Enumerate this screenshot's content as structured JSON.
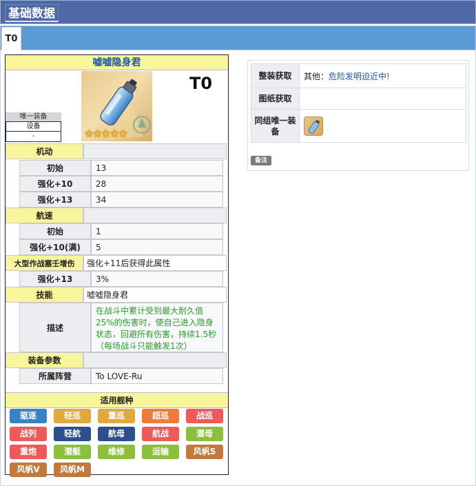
{
  "header": {
    "title": "基础数据"
  },
  "tabs": [
    {
      "label": "T0"
    }
  ],
  "equipment": {
    "name": "嘘嘘隐身君",
    "tier": "T0",
    "rarity_stars": "★★★★★",
    "unique_label": "唯一装备",
    "unique_category": "设备",
    "unique_value": "-",
    "sections": {
      "mobility": {
        "label": "机动",
        "rows": [
          {
            "label": "初始",
            "value": "13"
          },
          {
            "label": "强化+10",
            "value": "28"
          },
          {
            "label": "强化+13",
            "value": "34"
          }
        ]
      },
      "speed": {
        "label": "航速",
        "rows": [
          {
            "label": "初始",
            "value": "1"
          },
          {
            "label": "强化+10(满)",
            "value": "5"
          }
        ]
      },
      "ops": {
        "label": "大型作战塞壬增伤",
        "note": "强化+11后获得此属性",
        "rows": [
          {
            "label": "强化+13",
            "value": "3%"
          }
        ]
      },
      "skill": {
        "label": "技能",
        "name": "嘘嘘隐身君",
        "desc_label": "描述",
        "desc": "在战斗中累计受到最大耐久值25%的伤害时，使自己进入隐身状态，回避所有伤害，持续1.5秒（每场战斗只能触发1次）"
      },
      "params": {
        "label": "装备参数",
        "rows": [
          {
            "label": "所属阵营",
            "value": "To LOVE-Ru"
          }
        ]
      }
    },
    "ship_types_title": "适用舰种",
    "ship_types": [
      {
        "label": "驱逐",
        "color": "#3a82c4"
      },
      {
        "label": "轻巡",
        "color": "#e0a93a"
      },
      {
        "label": "重巡",
        "color": "#e0a93a"
      },
      {
        "label": "超巡",
        "color": "#f07a3a"
      },
      {
        "label": "战巡",
        "color": "#ee5a5a"
      },
      {
        "label": "战列",
        "color": "#ee5a5a"
      },
      {
        "label": "轻航",
        "color": "#2d4f8e"
      },
      {
        "label": "航母",
        "color": "#2d4f8e"
      },
      {
        "label": "航战",
        "color": "#ee5a5a"
      },
      {
        "label": "潜母",
        "color": "#8cbf3c"
      },
      {
        "label": "重炮",
        "color": "#ee5a5a"
      },
      {
        "label": "潜艇",
        "color": "#8cbf3c"
      },
      {
        "label": "维修",
        "color": "#8cbf3c"
      },
      {
        "label": "运输",
        "color": "#8cbf3c"
      },
      {
        "label": "风帆S",
        "color": "#c1793c"
      },
      {
        "label": "风帆V",
        "color": "#c1793c"
      },
      {
        "label": "风帆M",
        "color": "#c1793c"
      }
    ]
  },
  "acquisition": {
    "rows": [
      {
        "key": "整装获取",
        "prefix": "其他：",
        "link": "危险发明迫近中!"
      },
      {
        "key": "图纸获取",
        "prefix": "",
        "link": ""
      },
      {
        "key": "同组唯一装备",
        "prefix": "",
        "link": ""
      }
    ],
    "note_button": "备注"
  },
  "colors": {
    "header_bg": "#4e69a6",
    "tab_strip": "#5b9bd5",
    "section_yellow": "#f8f59a",
    "link": "#1e56a8",
    "desc_green": "#2b9a2b"
  }
}
